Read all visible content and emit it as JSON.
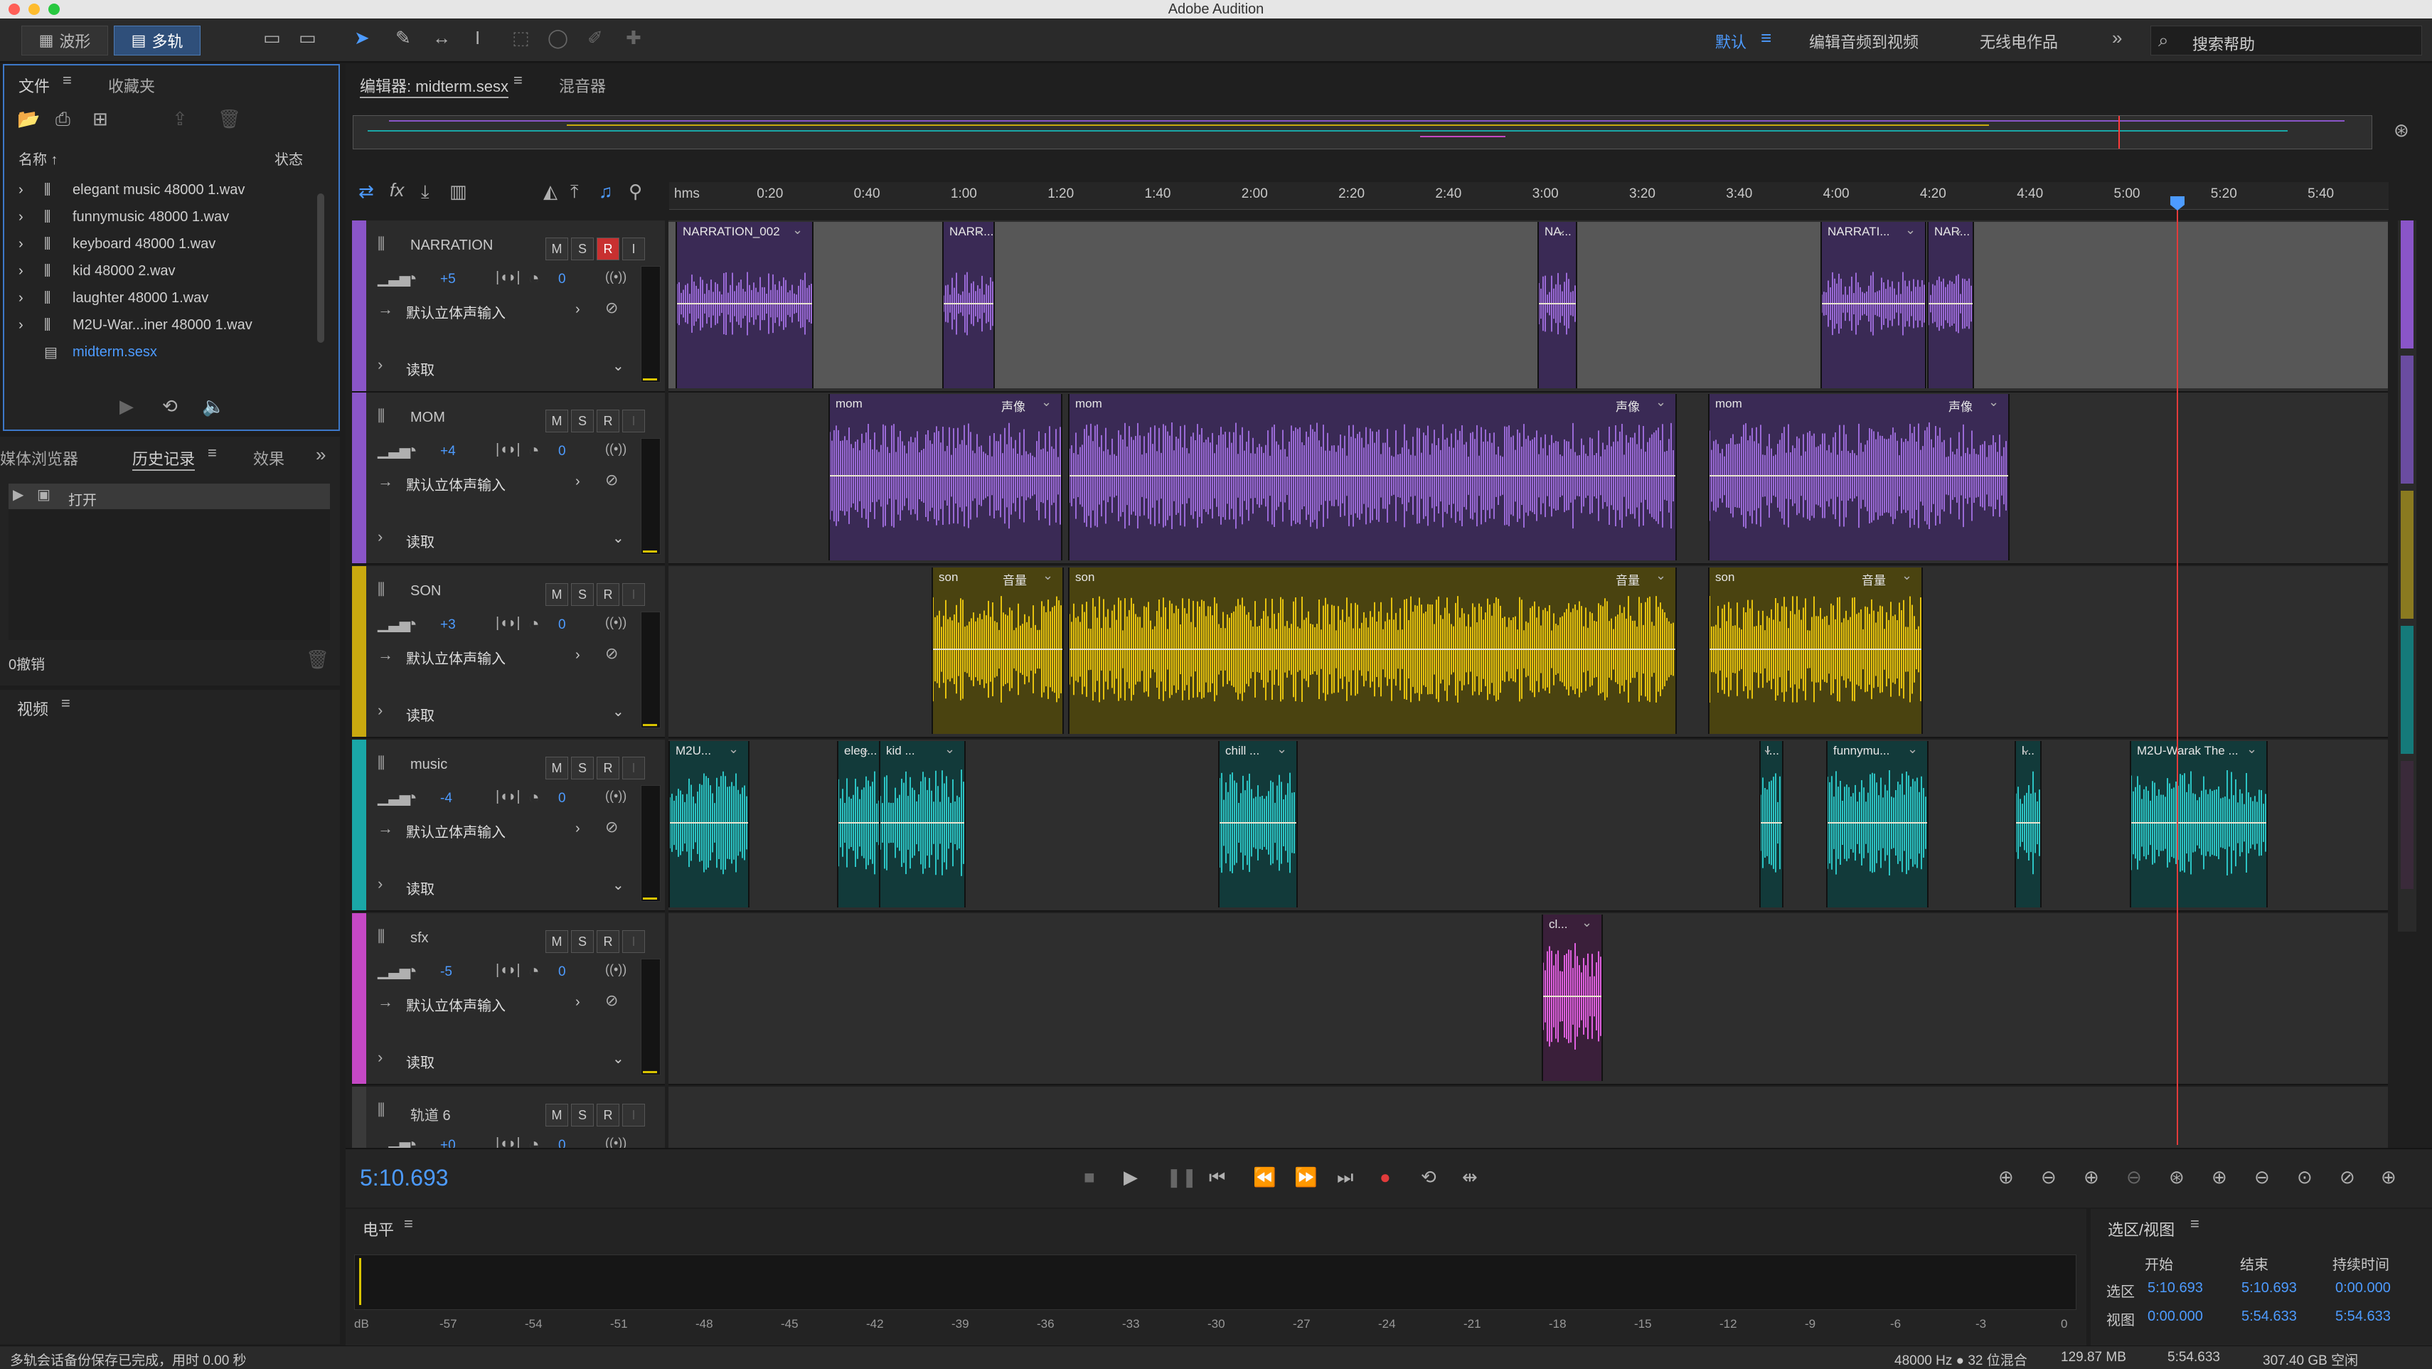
{
  "app_title": "Adobe Audition",
  "toolbar": {
    "waveform_label": "波形",
    "multitrack_label": "多轨",
    "workspace_default": "默认",
    "workspace_edit_video": "编辑音频到视频",
    "workspace_radio": "无线电作品",
    "search_placeholder": "搜索帮助"
  },
  "files_panel": {
    "tab_files": "文件",
    "tab_favorites": "收藏夹",
    "col_name": "名称 ↑",
    "col_status": "状态",
    "items": [
      "elegant music 48000 1.wav",
      "funnymusic 48000 1.wav",
      "keyboard 48000 1.wav",
      "kid 48000 2.wav",
      "laughter 48000 1.wav",
      "M2U-War...iner 48000 1.wav",
      "midterm.sesx"
    ]
  },
  "history_panel": {
    "tab_media": "媒体浏览器",
    "tab_history": "历史记录",
    "tab_effects": "效果",
    "item": "打开",
    "undo_count": "0撤销"
  },
  "video_panel": {
    "title": "视频"
  },
  "editor": {
    "tab_editor": "编辑器: midterm.sesx",
    "tab_mixer": "混音器"
  },
  "ruler": [
    "hms",
    "0:20",
    "0:40",
    "1:00",
    "1:20",
    "1:40",
    "2:00",
    "2:20",
    "2:40",
    "3:00",
    "3:20",
    "3:40",
    "4:00",
    "4:20",
    "4:40",
    "5:00",
    "5:20",
    "5:40"
  ],
  "tracks": [
    {
      "name": "NARRATION",
      "vol": "+5",
      "pan": "0",
      "input": "默认立体声输入",
      "mode": "读取",
      "color": "#8a55c8"
    },
    {
      "name": "MOM",
      "vol": "+4",
      "pan": "0",
      "input": "默认立体声输入",
      "mode": "读取",
      "color": "#8a55c8"
    },
    {
      "name": "SON",
      "vol": "+3",
      "pan": "0",
      "input": "默认立体声输入",
      "mode": "读取",
      "color": "#c9a90f"
    },
    {
      "name": "music",
      "vol": "-4",
      "pan": "0",
      "input": "默认立体声输入",
      "mode": "读取",
      "color": "#1aa7a7"
    },
    {
      "name": "sfx",
      "vol": "-5",
      "pan": "0",
      "input": "默认立体声输入",
      "mode": "读取",
      "color": "#c548c5"
    },
    {
      "name": "轨道 6",
      "vol": "+0",
      "pan": "0"
    }
  ],
  "track_buttons": {
    "m": "M",
    "s": "S",
    "r": "R",
    "i": "I"
  },
  "clips": {
    "narration": [
      "NARRATION_002",
      "NARR...",
      "NA...",
      "NARRATI...",
      "NAR..."
    ],
    "mom": [
      "mom",
      "mom",
      "mom"
    ],
    "mom_fx": "声像",
    "son": [
      "son",
      "son",
      "son"
    ],
    "son_fx": "音量",
    "music": [
      "M2U...",
      "eleg...",
      "kid ...",
      "chill ...",
      "l...",
      "funnymu...",
      "l...",
      "M2U-Warak The ..."
    ],
    "sfx": [
      "cl..."
    ]
  },
  "timecode": "5:10.693",
  "levels": {
    "title": "电平",
    "scale": [
      "dB",
      "-57",
      "-54",
      "-51",
      "-48",
      "-45",
      "-42",
      "-39",
      "-36",
      "-33",
      "-30",
      "-27",
      "-24",
      "-21",
      "-18",
      "-15",
      "-12",
      "-9",
      "-6",
      "-3",
      "0"
    ]
  },
  "selection": {
    "title": "选区/视图",
    "col_start": "开始",
    "col_end": "结束",
    "col_duration": "持续时间",
    "row_sel": "选区",
    "row_view": "视图",
    "sel_start": "5:10.693",
    "sel_end": "5:10.693",
    "sel_dur": "0:00.000",
    "view_start": "0:00.000",
    "view_end": "5:54.633",
    "view_dur": "5:54.633"
  },
  "status": {
    "left": "多轨会话备份保存已完成，用时 0.00 秒",
    "rate": "48000 Hz ● 32 位混合",
    "mem": "129.87 MB",
    "dur": "5:54.633",
    "disk": "307.40 GB 空闲"
  }
}
